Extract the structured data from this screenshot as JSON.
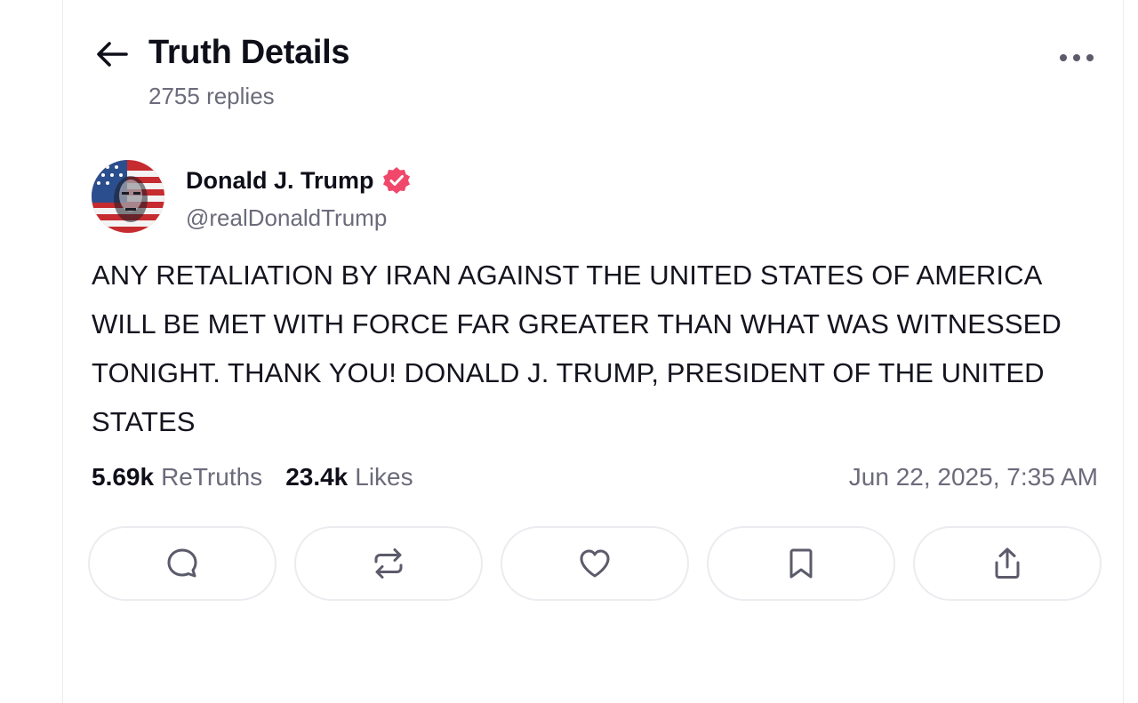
{
  "header": {
    "title": "Truth Details",
    "replies": "2755 replies",
    "back_icon": "arrow-left-icon",
    "more_icon": "ellipsis-icon"
  },
  "post": {
    "author_name": "Donald J. Trump",
    "handle": "@realDonaldTrump",
    "verified": true,
    "verified_color": "#f0476b",
    "text": "ANY RETALIATION BY IRAN AGAINST THE UNITED STATES OF AMERICA WILL BE MET WITH FORCE FAR GREATER THAN WHAT WAS WITNESSED TONIGHT. THANK YOU! DONALD J. TRUMP, PRESIDENT OF THE UNITED STATES",
    "retruths_count": "5.69k",
    "retruths_label": "ReTruths",
    "likes_count": "23.4k",
    "likes_label": "Likes",
    "timestamp": "Jun 22, 2025, 7:35 AM"
  },
  "actions": [
    {
      "name": "reply",
      "icon": "comment-icon"
    },
    {
      "name": "retruth",
      "icon": "repost-icon"
    },
    {
      "name": "like",
      "icon": "heart-icon"
    },
    {
      "name": "bookmark",
      "icon": "bookmark-icon"
    },
    {
      "name": "share",
      "icon": "share-icon"
    }
  ],
  "colors": {
    "text_primary": "#0f0f1a",
    "text_secondary": "#6b6b7b",
    "border": "#ececf0",
    "icon": "#5b5b6b"
  }
}
